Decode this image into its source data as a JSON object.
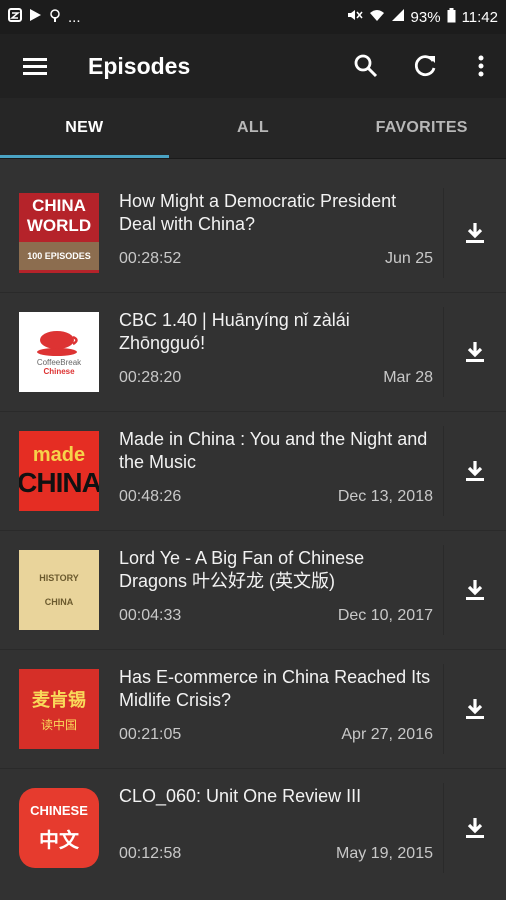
{
  "status": {
    "left_text": "...",
    "battery": "93%",
    "time": "11:42"
  },
  "appbar": {
    "title": "Episodes"
  },
  "tabs": [
    {
      "label": "NEW",
      "active": true
    },
    {
      "label": "ALL",
      "active": false
    },
    {
      "label": "FAVORITES",
      "active": false
    }
  ],
  "episodes": [
    {
      "title": "How Might a Democratic President Deal with China?",
      "duration": "00:28:52",
      "date": "Jun 25",
      "thumb": {
        "line1": "CHINA",
        "line2": "WORLD",
        "band": "100 EPISODES"
      }
    },
    {
      "title": "CBC 1.40 | Huānyíng nǐ zàlái Zhōngguó!",
      "duration": "00:28:20",
      "date": "Mar 28",
      "thumb": {
        "line1": "CoffeeBreak",
        "line2": "Chinese"
      }
    },
    {
      "title": "Made in China : You and the Night and the Music",
      "duration": "00:48:26",
      "date": "Dec 13, 2018",
      "thumb": {
        "line1": "made",
        "line2": "CHINA"
      }
    },
    {
      "title": "Lord Ye - A Big Fan of Chinese Dragons 叶公好龙 (英文版)",
      "duration": "00:04:33",
      "date": "Dec 10, 2017",
      "thumb": {
        "line1": "HISTORY",
        "line2": "CHINA"
      }
    },
    {
      "title": "Has E-commerce in China Reached Its Midlife Crisis?",
      "duration": "00:21:05",
      "date": "Apr 27, 2016",
      "thumb": {
        "line1": "麦肯锡",
        "line2": "读中国"
      }
    },
    {
      "title": "CLO_060: Unit One Review III",
      "duration": "00:12:58",
      "date": "May 19, 2015",
      "thumb": {
        "line1": "CHINESE",
        "line2": "中文"
      }
    }
  ],
  "colors": {
    "background": "#323232",
    "appbar": "#212121",
    "accent": "#4aa3c4"
  }
}
